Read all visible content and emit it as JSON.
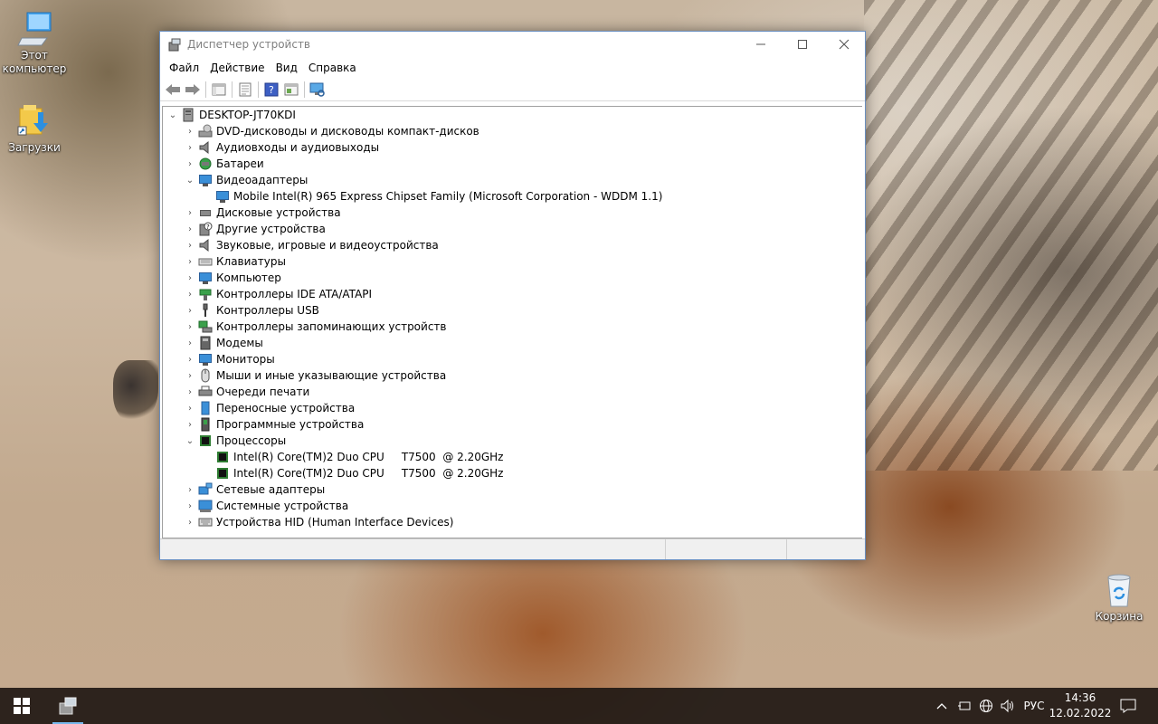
{
  "desktop": {
    "icons": [
      {
        "label": "Этот компьютер",
        "icon": "this-pc-icon"
      },
      {
        "label": "Загрузки",
        "icon": "downloads-folder-icon"
      },
      {
        "label": "Корзина",
        "icon": "recycle-bin-icon"
      }
    ]
  },
  "window": {
    "title": "Диспетчер устройств",
    "menu": [
      "Файл",
      "Действие",
      "Вид",
      "Справка"
    ],
    "toolbar_icons": [
      "back-arrow-icon",
      "forward-arrow-icon",
      "show-hide-tree-icon",
      "properties-icon",
      "help-icon",
      "view-icon",
      "scan-hardware-icon"
    ],
    "tree": {
      "root": "DESKTOP-JT70KDI",
      "categories": [
        {
          "label": "DVD-дисководы и дисководы компакт-дисков",
          "expanded": false
        },
        {
          "label": "Аудиовходы и аудиовыходы",
          "expanded": false
        },
        {
          "label": "Батареи",
          "expanded": false
        },
        {
          "label": "Видеоадаптеры",
          "expanded": true,
          "children": [
            "Mobile Intel(R) 965 Express Chipset Family (Microsoft Corporation - WDDM 1.1)"
          ]
        },
        {
          "label": "Дисковые устройства",
          "expanded": false
        },
        {
          "label": "Другие устройства",
          "expanded": false
        },
        {
          "label": "Звуковые, игровые и видеоустройства",
          "expanded": false
        },
        {
          "label": "Клавиатуры",
          "expanded": false
        },
        {
          "label": "Компьютер",
          "expanded": false
        },
        {
          "label": "Контроллеры IDE ATA/ATAPI",
          "expanded": false
        },
        {
          "label": "Контроллеры USB",
          "expanded": false
        },
        {
          "label": "Контроллеры запоминающих устройств",
          "expanded": false
        },
        {
          "label": "Модемы",
          "expanded": false
        },
        {
          "label": "Мониторы",
          "expanded": false
        },
        {
          "label": "Мыши и иные указывающие устройства",
          "expanded": false
        },
        {
          "label": "Очереди печати",
          "expanded": false
        },
        {
          "label": "Переносные устройства",
          "expanded": false
        },
        {
          "label": "Программные устройства",
          "expanded": false
        },
        {
          "label": "Процессоры",
          "expanded": true,
          "children": [
            "Intel(R) Core(TM)2 Duo CPU     T7500  @ 2.20GHz",
            "Intel(R) Core(TM)2 Duo CPU     T7500  @ 2.20GHz"
          ]
        },
        {
          "label": "Сетевые адаптеры",
          "expanded": false
        },
        {
          "label": "Системные устройства",
          "expanded": false
        },
        {
          "label": "Устройства HID (Human Interface Devices)",
          "expanded": false
        }
      ]
    }
  },
  "taskbar": {
    "language": "РУС",
    "time": "14:36",
    "date": "12.02.2022"
  }
}
